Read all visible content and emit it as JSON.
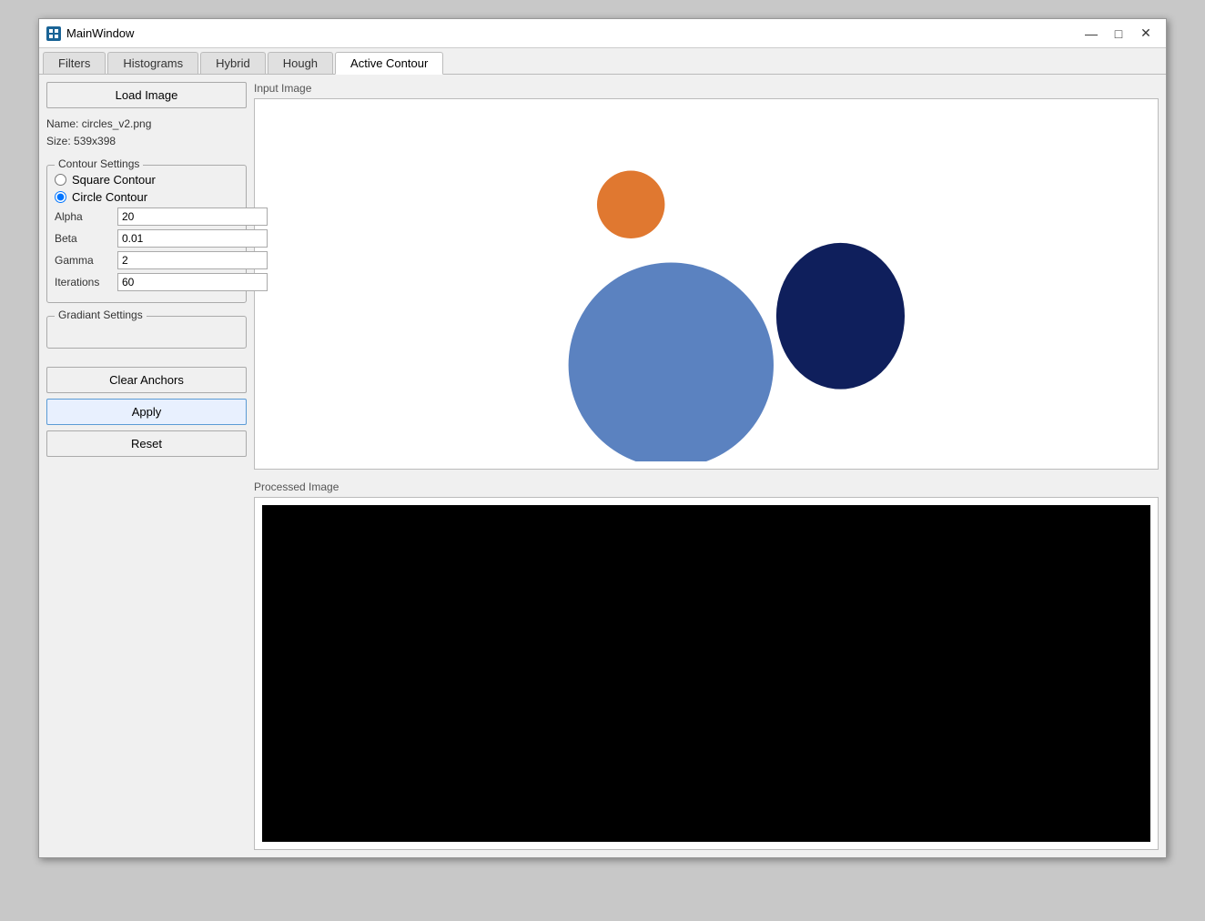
{
  "window": {
    "title": "MainWindow",
    "icon": "window-icon"
  },
  "titlebar": {
    "minimize": "—",
    "maximize": "□",
    "close": "✕"
  },
  "tabs": [
    {
      "label": "Filters",
      "active": false
    },
    {
      "label": "Histograms",
      "active": false
    },
    {
      "label": "Hybrid",
      "active": false
    },
    {
      "label": "Hough",
      "active": false
    },
    {
      "label": "Active Contour",
      "active": true
    }
  ],
  "sidebar": {
    "load_button": "Load Image",
    "file_name_label": "Name:",
    "file_name": "circles_v2.png",
    "file_size_label": "Size:",
    "file_size": "539x398",
    "contour_group_title": "Contour Settings",
    "square_contour_label": "Square Contour",
    "circle_contour_label": "Circle Contour",
    "alpha_label": "Alpha",
    "alpha_value": "20",
    "beta_label": "Beta",
    "beta_value": "0.01",
    "gamma_label": "Gamma",
    "gamma_value": "2",
    "iterations_label": "Iterations",
    "iterations_value": "60",
    "gradient_group_title": "Gradiant Settings",
    "clear_anchors_btn": "Clear Anchors",
    "apply_btn": "Apply",
    "reset_btn": "Reset"
  },
  "input_image_label": "Input Image",
  "processed_image_label": "Processed Image",
  "colors": {
    "orange_circle": "#E07830",
    "blue_circle": "#5B82C0",
    "dark_blue_circle": "#0F1F5C"
  }
}
